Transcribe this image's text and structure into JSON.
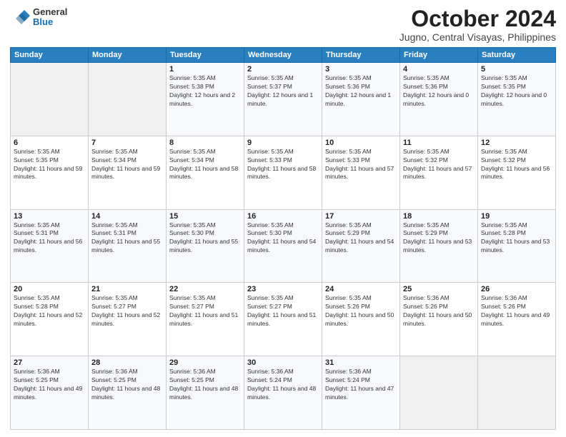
{
  "logo": {
    "general": "General",
    "blue": "Blue"
  },
  "title": "October 2024",
  "location": "Jugno, Central Visayas, Philippines",
  "days_header": [
    "Sunday",
    "Monday",
    "Tuesday",
    "Wednesday",
    "Thursday",
    "Friday",
    "Saturday"
  ],
  "weeks": [
    [
      {
        "day": "",
        "sunrise": "",
        "sunset": "",
        "daylight": ""
      },
      {
        "day": "",
        "sunrise": "",
        "sunset": "",
        "daylight": ""
      },
      {
        "day": "1",
        "sunrise": "Sunrise: 5:35 AM",
        "sunset": "Sunset: 5:38 PM",
        "daylight": "Daylight: 12 hours and 2 minutes."
      },
      {
        "day": "2",
        "sunrise": "Sunrise: 5:35 AM",
        "sunset": "Sunset: 5:37 PM",
        "daylight": "Daylight: 12 hours and 1 minute."
      },
      {
        "day": "3",
        "sunrise": "Sunrise: 5:35 AM",
        "sunset": "Sunset: 5:36 PM",
        "daylight": "Daylight: 12 hours and 1 minute."
      },
      {
        "day": "4",
        "sunrise": "Sunrise: 5:35 AM",
        "sunset": "Sunset: 5:36 PM",
        "daylight": "Daylight: 12 hours and 0 minutes."
      },
      {
        "day": "5",
        "sunrise": "Sunrise: 5:35 AM",
        "sunset": "Sunset: 5:35 PM",
        "daylight": "Daylight: 12 hours and 0 minutes."
      }
    ],
    [
      {
        "day": "6",
        "sunrise": "Sunrise: 5:35 AM",
        "sunset": "Sunset: 5:35 PM",
        "daylight": "Daylight: 11 hours and 59 minutes."
      },
      {
        "day": "7",
        "sunrise": "Sunrise: 5:35 AM",
        "sunset": "Sunset: 5:34 PM",
        "daylight": "Daylight: 11 hours and 59 minutes."
      },
      {
        "day": "8",
        "sunrise": "Sunrise: 5:35 AM",
        "sunset": "Sunset: 5:34 PM",
        "daylight": "Daylight: 11 hours and 58 minutes."
      },
      {
        "day": "9",
        "sunrise": "Sunrise: 5:35 AM",
        "sunset": "Sunset: 5:33 PM",
        "daylight": "Daylight: 11 hours and 58 minutes."
      },
      {
        "day": "10",
        "sunrise": "Sunrise: 5:35 AM",
        "sunset": "Sunset: 5:33 PM",
        "daylight": "Daylight: 11 hours and 57 minutes."
      },
      {
        "day": "11",
        "sunrise": "Sunrise: 5:35 AM",
        "sunset": "Sunset: 5:32 PM",
        "daylight": "Daylight: 11 hours and 57 minutes."
      },
      {
        "day": "12",
        "sunrise": "Sunrise: 5:35 AM",
        "sunset": "Sunset: 5:32 PM",
        "daylight": "Daylight: 11 hours and 56 minutes."
      }
    ],
    [
      {
        "day": "13",
        "sunrise": "Sunrise: 5:35 AM",
        "sunset": "Sunset: 5:31 PM",
        "daylight": "Daylight: 11 hours and 56 minutes."
      },
      {
        "day": "14",
        "sunrise": "Sunrise: 5:35 AM",
        "sunset": "Sunset: 5:31 PM",
        "daylight": "Daylight: 11 hours and 55 minutes."
      },
      {
        "day": "15",
        "sunrise": "Sunrise: 5:35 AM",
        "sunset": "Sunset: 5:30 PM",
        "daylight": "Daylight: 11 hours and 55 minutes."
      },
      {
        "day": "16",
        "sunrise": "Sunrise: 5:35 AM",
        "sunset": "Sunset: 5:30 PM",
        "daylight": "Daylight: 11 hours and 54 minutes."
      },
      {
        "day": "17",
        "sunrise": "Sunrise: 5:35 AM",
        "sunset": "Sunset: 5:29 PM",
        "daylight": "Daylight: 11 hours and 54 minutes."
      },
      {
        "day": "18",
        "sunrise": "Sunrise: 5:35 AM",
        "sunset": "Sunset: 5:29 PM",
        "daylight": "Daylight: 11 hours and 53 minutes."
      },
      {
        "day": "19",
        "sunrise": "Sunrise: 5:35 AM",
        "sunset": "Sunset: 5:28 PM",
        "daylight": "Daylight: 11 hours and 53 minutes."
      }
    ],
    [
      {
        "day": "20",
        "sunrise": "Sunrise: 5:35 AM",
        "sunset": "Sunset: 5:28 PM",
        "daylight": "Daylight: 11 hours and 52 minutes."
      },
      {
        "day": "21",
        "sunrise": "Sunrise: 5:35 AM",
        "sunset": "Sunset: 5:27 PM",
        "daylight": "Daylight: 11 hours and 52 minutes."
      },
      {
        "day": "22",
        "sunrise": "Sunrise: 5:35 AM",
        "sunset": "Sunset: 5:27 PM",
        "daylight": "Daylight: 11 hours and 51 minutes."
      },
      {
        "day": "23",
        "sunrise": "Sunrise: 5:35 AM",
        "sunset": "Sunset: 5:27 PM",
        "daylight": "Daylight: 11 hours and 51 minutes."
      },
      {
        "day": "24",
        "sunrise": "Sunrise: 5:35 AM",
        "sunset": "Sunset: 5:26 PM",
        "daylight": "Daylight: 11 hours and 50 minutes."
      },
      {
        "day": "25",
        "sunrise": "Sunrise: 5:36 AM",
        "sunset": "Sunset: 5:26 PM",
        "daylight": "Daylight: 11 hours and 50 minutes."
      },
      {
        "day": "26",
        "sunrise": "Sunrise: 5:36 AM",
        "sunset": "Sunset: 5:26 PM",
        "daylight": "Daylight: 11 hours and 49 minutes."
      }
    ],
    [
      {
        "day": "27",
        "sunrise": "Sunrise: 5:36 AM",
        "sunset": "Sunset: 5:25 PM",
        "daylight": "Daylight: 11 hours and 49 minutes."
      },
      {
        "day": "28",
        "sunrise": "Sunrise: 5:36 AM",
        "sunset": "Sunset: 5:25 PM",
        "daylight": "Daylight: 11 hours and 48 minutes."
      },
      {
        "day": "29",
        "sunrise": "Sunrise: 5:36 AM",
        "sunset": "Sunset: 5:25 PM",
        "daylight": "Daylight: 11 hours and 48 minutes."
      },
      {
        "day": "30",
        "sunrise": "Sunrise: 5:36 AM",
        "sunset": "Sunset: 5:24 PM",
        "daylight": "Daylight: 11 hours and 48 minutes."
      },
      {
        "day": "31",
        "sunrise": "Sunrise: 5:36 AM",
        "sunset": "Sunset: 5:24 PM",
        "daylight": "Daylight: 11 hours and 47 minutes."
      },
      {
        "day": "",
        "sunrise": "",
        "sunset": "",
        "daylight": ""
      },
      {
        "day": "",
        "sunrise": "",
        "sunset": "",
        "daylight": ""
      }
    ]
  ]
}
